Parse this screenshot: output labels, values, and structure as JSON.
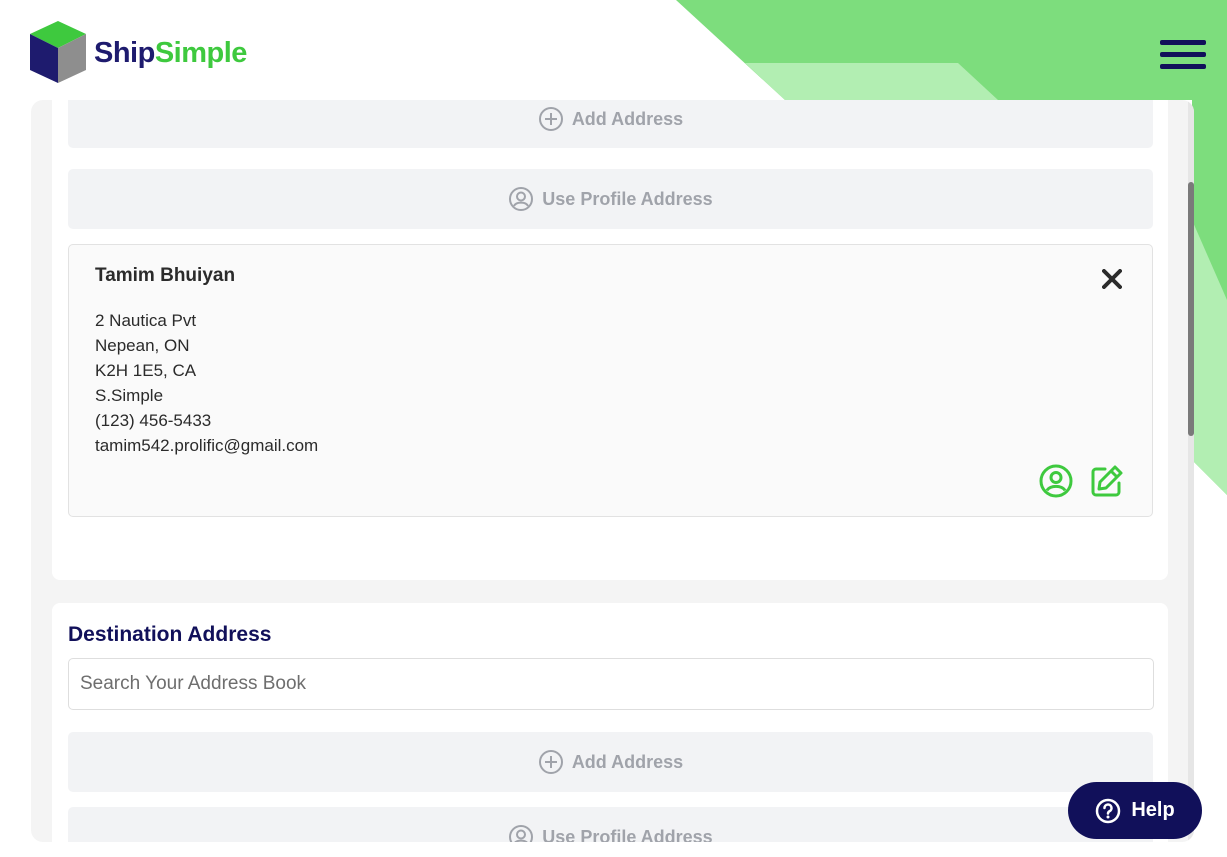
{
  "brand": {
    "name_part1": "Ship",
    "name_part2": "Simple",
    "colors": {
      "navy": "#11105a",
      "green": "#3ec93e",
      "decor_green": "#7ddd7d",
      "decor_light_green": "#b2eeb2"
    }
  },
  "header": {
    "menu_icon": "hamburger-menu-icon"
  },
  "origin": {
    "add_address_label": "Add Address",
    "use_profile_label": "Use Profile Address",
    "selected_address": {
      "name": "Tamim Bhuiyan",
      "street": "2 Nautica Pvt",
      "city_province": "Nepean, ON",
      "postal_country": "K2H 1E5, CA",
      "company": "S.Simple",
      "phone": "(123) 456-5433",
      "email": "tamim542.prolific@gmail.com"
    }
  },
  "destination": {
    "title": "Destination Address",
    "search_placeholder": "Search Your Address Book",
    "add_address_label": "Add Address",
    "use_profile_label": "Use Profile Address"
  },
  "help": {
    "label": "Help"
  }
}
